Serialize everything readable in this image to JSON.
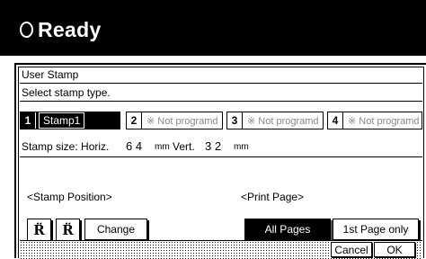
{
  "status": {
    "title": "Ready",
    "icon": "circle-ready-icon"
  },
  "dialog": {
    "title": "User Stamp",
    "instruction": "Select stamp type.",
    "stamps": [
      {
        "number": "1",
        "label": "Stamp1",
        "selected": true
      },
      {
        "number": "2",
        "label": "※ Not programd",
        "selected": false
      },
      {
        "number": "3",
        "label": "※ Not programd",
        "selected": false
      },
      {
        "number": "4",
        "label": "※ Not programd",
        "selected": false
      }
    ],
    "stamp_size": {
      "label": "Stamp size: Horiz.",
      "horiz_value": "6 4",
      "unit": "mm",
      "vert_label": "Vert.",
      "vert_value": "3 2"
    },
    "stamp_position": {
      "heading": "<Stamp Position>",
      "change_label": "Change",
      "icons": [
        "stamp-position-top-left-icon",
        "stamp-position-top-right-icon"
      ]
    },
    "print_page": {
      "heading": "<Print Page>",
      "options": [
        "All Pages",
        "1st Page only"
      ],
      "selected": "All Pages"
    },
    "footer": {
      "cancel_label": "Cancel",
      "ok_label": "OK"
    }
  }
}
